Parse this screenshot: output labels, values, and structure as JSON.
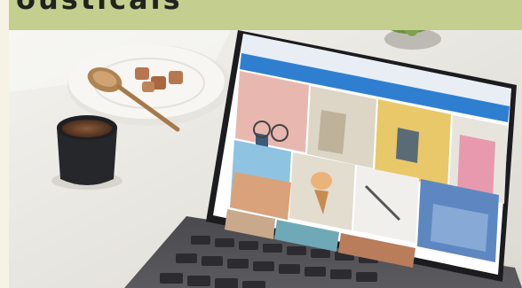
{
  "banner": {
    "text": "ousticals",
    "color": "#c4cf8f"
  },
  "photo": {
    "subject": "laptop-photo-browser-with-coffee",
    "colors": {
      "table": "#ece9e2",
      "laptop_body": "#2b2b2e",
      "browser_header": "#2f7fd0",
      "coffee_cup": "#25272a"
    }
  }
}
